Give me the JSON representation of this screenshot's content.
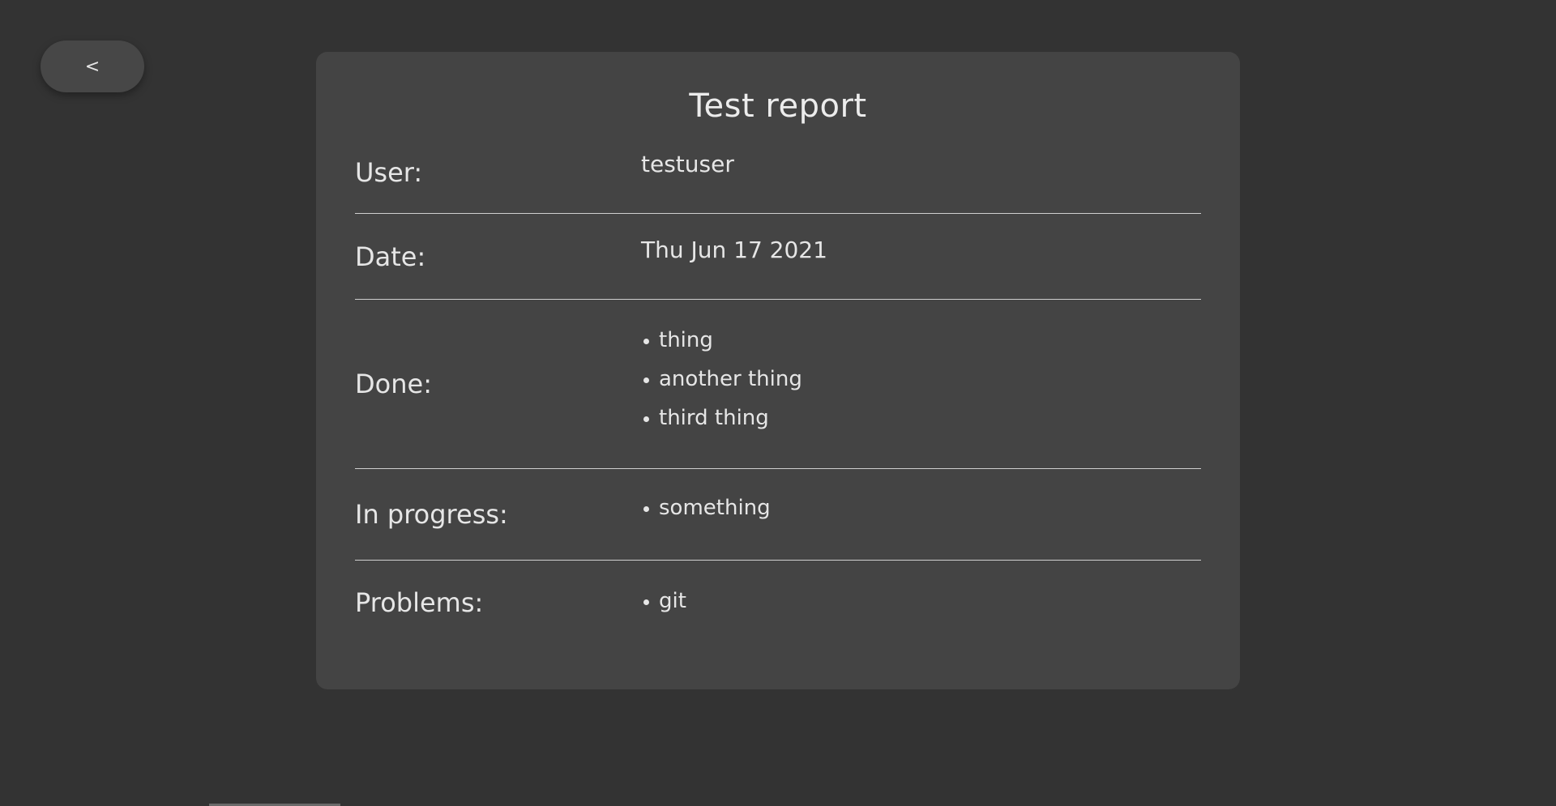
{
  "back_button": {
    "label": "<"
  },
  "report": {
    "title": "Test report",
    "rows": [
      {
        "label": "User:",
        "value": "testuser"
      },
      {
        "label": "Date:",
        "value": "Thu Jun 17 2021"
      },
      {
        "label": "Done:",
        "items": [
          "thing",
          "another thing",
          "third thing"
        ]
      },
      {
        "label": "In progress:",
        "items": [
          "something"
        ]
      },
      {
        "label": "Problems:",
        "items": [
          "git"
        ]
      }
    ]
  }
}
